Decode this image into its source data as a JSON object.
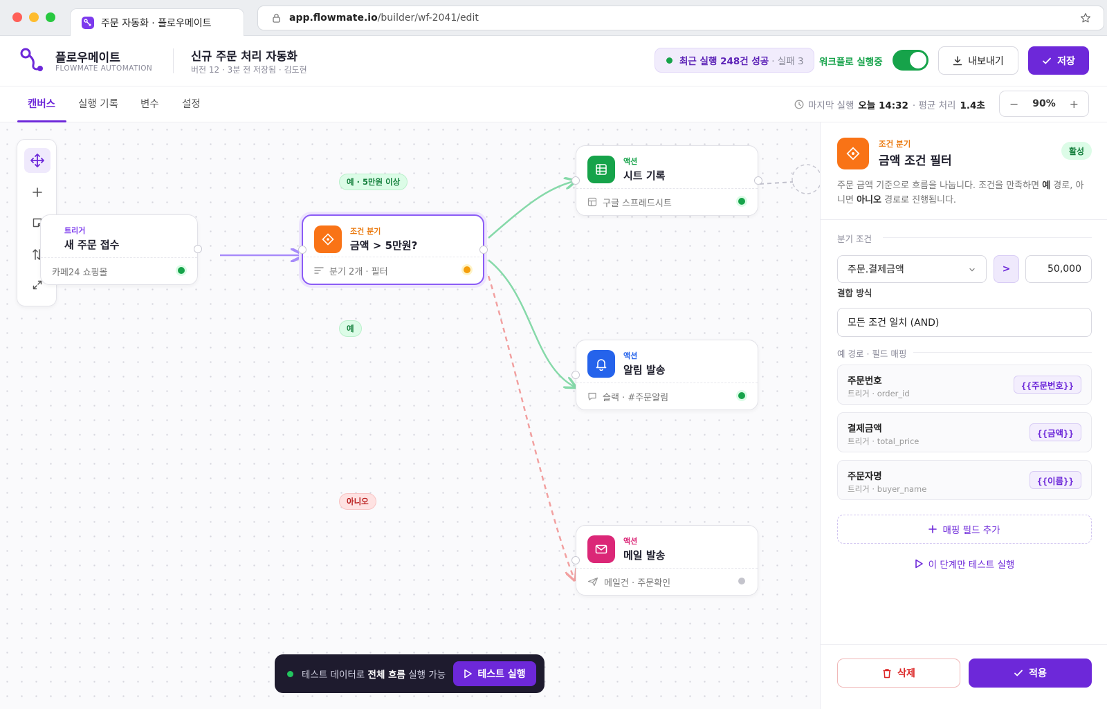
{
  "browser": {
    "tab_title": "주문 자동화 · 플로우메이트",
    "url_host": "app.flowmate.io",
    "url_path": "/builder/wf-2041/edit"
  },
  "header": {
    "brand_name": "플로우메이트",
    "brand_sub": "FLOWMATE AUTOMATION",
    "workflow_title": "신규 주문 처리 자동화",
    "workflow_meta": "버전 12 · 3분 전 저장됨 · 김도현",
    "run_summary": "최근 실행 248건 성공",
    "run_fail": "· 실패 3",
    "active_label": "워크플로 실행중",
    "active": true,
    "export_label": "내보내기",
    "save_label": "저장"
  },
  "tabs": [
    {
      "label": "캔버스",
      "active": true
    },
    {
      "label": "실행 기록",
      "active": false
    },
    {
      "label": "변수",
      "active": false
    },
    {
      "label": "설정",
      "active": false
    }
  ],
  "status": {
    "last_run_label": "마지막 실행",
    "last_run_value": "오늘 14:32",
    "avg_label": "· 평균 처리",
    "avg_value": "1.4초",
    "zoom": "90%"
  },
  "nodes": {
    "trigger": {
      "type": "트리거",
      "title": "새 주문 접수",
      "footer": "카페24 쇼핑몰",
      "status": "active"
    },
    "condition": {
      "type": "조건 분기",
      "title": "금액 > 5만원?",
      "footer": "분기 2개 · 필터",
      "status": "selected"
    },
    "sheet": {
      "type": "액션",
      "title": "시트 기록",
      "footer": "구글 스프레드시트",
      "status": "active"
    },
    "notify": {
      "type": "액션",
      "title": "알림 발송",
      "footer": "슬랙 · #주문알림",
      "status": "active"
    },
    "mail": {
      "type": "액션",
      "title": "메일 발송",
      "footer": "메일건 · 주문확인",
      "status": "inactive"
    }
  },
  "edge_labels": {
    "yes_high": "예 · 5만원 이상",
    "yes": "예",
    "no": "아니오"
  },
  "testbar": {
    "text_prefix": "테스트 데이터로",
    "text_bold": "전체 흐름",
    "text_suffix": "실행 가능",
    "button": "테스트 실행"
  },
  "panel": {
    "type": "조건 분기",
    "title": "금액 조건 필터",
    "badge": "활성",
    "desc_1": "주문 금액 기준으로 흐름을 나눕니다. 조건을 만족하면",
    "desc_yes": "예",
    "desc_2": "경로, 아니면",
    "desc_no": "아니오",
    "desc_3": "경로로 진행됩니다.",
    "branch_label": "분기 조건",
    "field": "주문.결제금액",
    "operator": ">",
    "value": "50,000",
    "combine_label": "결합 방식",
    "combine_value": "모든 조건 일치 (AND)",
    "mapping_label": "예 경로 · 필드 매핑",
    "mappings": [
      {
        "name": "주문번호",
        "source": "트리거 · order_id",
        "token": "{{주문번호}}"
      },
      {
        "name": "결제금액",
        "source": "트리거 · total_price",
        "token": "{{금액}}"
      },
      {
        "name": "주문자명",
        "source": "트리거 · buyer_name",
        "token": "{{이름}}"
      }
    ],
    "add_mapping": "매핑 필드 추가",
    "test_step": "이 단계만 테스트 실행",
    "delete": "삭제",
    "apply": "적용"
  },
  "colors": {
    "accent": "#6d28d9",
    "success": "#16a34a",
    "warning": "#f97316",
    "danger": "#dc2626"
  }
}
